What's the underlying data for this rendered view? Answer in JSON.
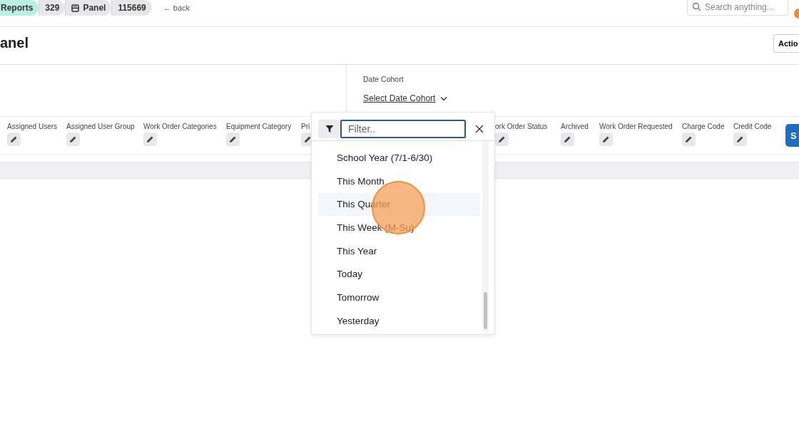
{
  "breadcrumbs": [
    {
      "label": "Reports",
      "kind": "section"
    },
    {
      "label": "329",
      "kind": "plain"
    },
    {
      "label": "Panel",
      "kind": "panel"
    },
    {
      "label": "115669",
      "kind": "plain"
    }
  ],
  "back_arrow": "←",
  "back_link": "back",
  "search": {
    "placeholder": "Search anything..."
  },
  "page_title": "anel",
  "actions_button": "Actio",
  "date_cohort": {
    "label": "Date Cohort",
    "link": "Select Date Cohort"
  },
  "filter_columns": [
    {
      "label": "Assigned Users"
    },
    {
      "label": "Assigned User Group"
    },
    {
      "label": "Work Order Categories"
    },
    {
      "label": "Equipment Category"
    },
    {
      "label": "Pri"
    },
    {
      "label": "ork Order Status"
    },
    {
      "label": "Archived"
    },
    {
      "label": "Work Order Requested"
    },
    {
      "label": "Charge Code"
    },
    {
      "label": "Credit Code"
    }
  ],
  "submit_button": "S",
  "dropdown": {
    "filter_placeholder": "Filter..",
    "options": [
      {
        "label": "School Year (7/1-6/30)",
        "selected": false
      },
      {
        "label": "This Month",
        "selected": false
      },
      {
        "label": "This Quarter",
        "selected": true
      },
      {
        "label": "This Week (M-Su)",
        "selected": false
      },
      {
        "label": "This Year",
        "selected": false
      },
      {
        "label": "Today",
        "selected": false
      },
      {
        "label": "Tomorrow",
        "selected": false
      },
      {
        "label": "Yesterday",
        "selected": false
      }
    ]
  }
}
